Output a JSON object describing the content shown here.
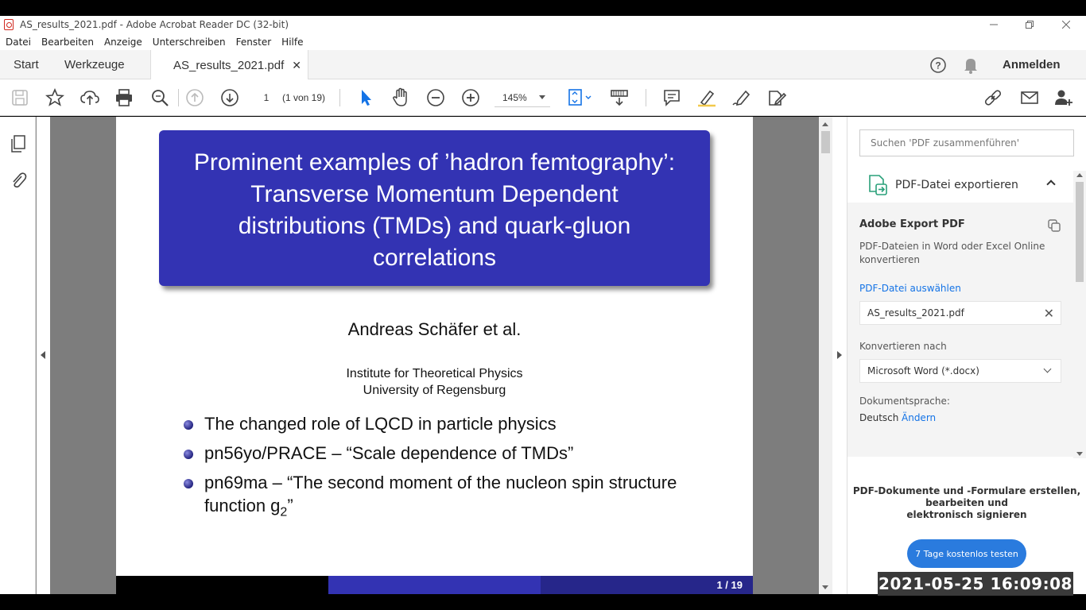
{
  "window": {
    "title": "AS_results_2021.pdf - Adobe Acrobat Reader DC (32-bit)"
  },
  "menu": [
    "Datei",
    "Bearbeiten",
    "Anzeige",
    "Unterschreiben",
    "Fenster",
    "Hilfe"
  ],
  "tabs": {
    "start": "Start",
    "tools": "Werkzeuge",
    "document": "AS_results_2021.pdf",
    "close": "✕",
    "signin": "Anmelden"
  },
  "toolbar": {
    "page_current": "1",
    "page_of": "(1 von 19)",
    "zoom": "145%"
  },
  "slide": {
    "title_lines": [
      "Prominent examples of ’hadron femtography’:",
      "Transverse Momentum Dependent",
      "distributions (TMDs) and quark-gluon",
      "correlations"
    ],
    "author": "Andreas Schäfer et al.",
    "institute": "Institute for Theoretical Physics",
    "university": "University of Regensburg",
    "bullets": [
      "The changed role of LQCD in particle physics",
      "pn56yo/PRACE – “Scale dependence of TMDs”",
      "pn69ma – “The second moment of the nucleon spin structure function g",
      "2",
      "”"
    ],
    "page_label": "1 / 19",
    "colors": {
      "title_bg": "#3333b3",
      "footer_mid": "#3333b3",
      "footer_right": "#26268a"
    }
  },
  "right_panel": {
    "search_placeholder": "Suchen 'PDF zusammenführen'",
    "section_title": "PDF-Datei exportieren",
    "export_heading": "Adobe Export PDF",
    "export_desc": "PDF-Dateien in Word oder Excel Online konvertieren",
    "select_file": "PDF-Datei auswählen",
    "file_name": "AS_results_2021.pdf",
    "convert_label": "Konvertieren nach",
    "convert_value": "Microsoft Word (*.docx)",
    "lang_label": "Dokumentsprache:",
    "lang_value": "Deutsch",
    "lang_change": "Ändern",
    "promo_line1": "PDF-Dokumente und -Formulare erstellen,",
    "promo_line2": "bearbeiten und",
    "promo_line3": "elektronisch signieren",
    "trial_button": "7 Tage kostenlos testen"
  },
  "timestamp": "2021-05-25 16:09:08"
}
